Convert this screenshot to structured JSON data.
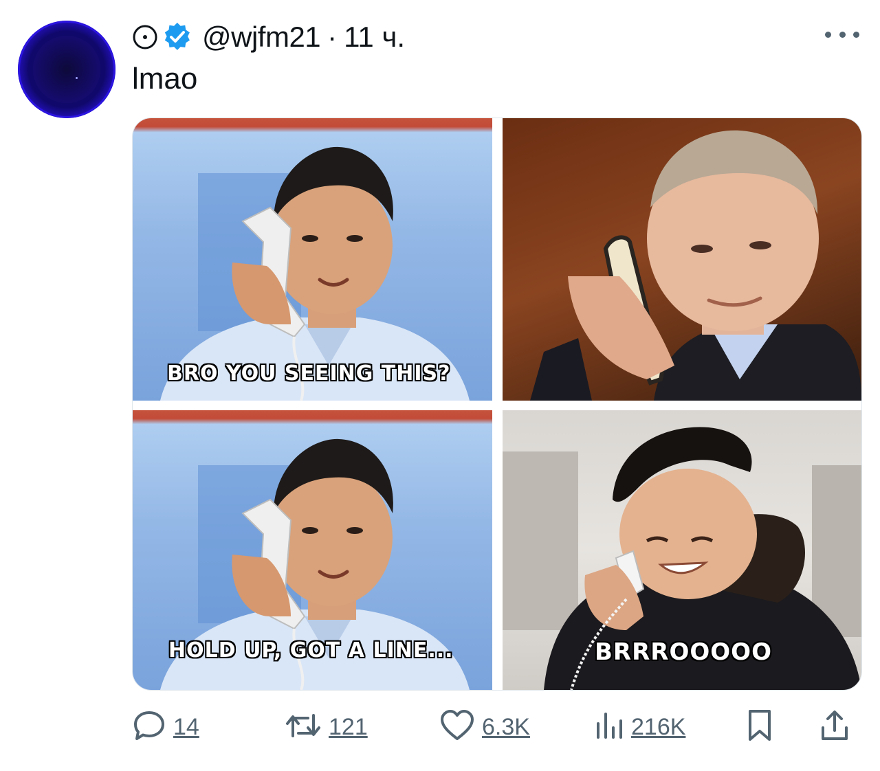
{
  "tweet": {
    "handle": "@wjfm21",
    "separator": "·",
    "time": "11 ч.",
    "text": "lmao"
  },
  "media": {
    "captions": {
      "top_left": "BRO YOU SEEING THIS?",
      "bottom_left": "HOLD UP, GOT A LINE...",
      "bottom_right": "BRRROOOOO"
    }
  },
  "actions": {
    "replies": "14",
    "retweets": "121",
    "likes": "6.3K",
    "views": "216K"
  },
  "icons": {
    "status": "circle-dot-icon",
    "verified": "verified-badge-icon",
    "more": "more-icon",
    "reply": "reply-icon",
    "retweet": "retweet-icon",
    "like": "heart-icon",
    "views": "views-icon",
    "bookmark": "bookmark-icon",
    "share": "share-icon"
  },
  "colors": {
    "verified": "#1d9bf0",
    "secondary_text": "#536471",
    "avatar": "#2b14e0"
  }
}
